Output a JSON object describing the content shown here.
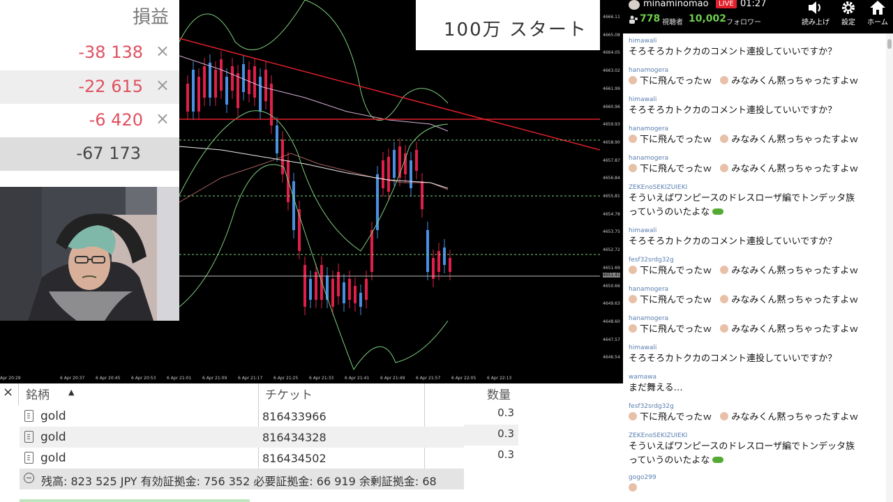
{
  "pl_panel": {
    "header": "損益",
    "rows": [
      {
        "value": "-38 138",
        "close": "×"
      },
      {
        "value": "-22 615",
        "close": "×"
      },
      {
        "value": "-6 420",
        "close": "×"
      }
    ],
    "total": "-67 173"
  },
  "overlay_text": "100万 スタート",
  "price_axis": [
    "4666.11",
    "4665.08",
    "4664.05",
    "4663.02",
    "4661.99",
    "4660.96",
    "4659.93",
    "4658.90",
    "4657.87",
    "4656.84",
    "4655.81",
    "4654.78",
    "4653.75",
    "4652.72",
    "4651.69",
    "4651.41",
    "4650.66",
    "4649.63",
    "4648.60",
    "4647.57",
    "4646.54"
  ],
  "time_axis": [
    "Apr 20:29",
    "6 Apr 20:37",
    "6 Apr 20:45",
    "6 Apr 20:53",
    "6 Apr 21:01",
    "6 Apr 21:09",
    "6 Apr 21:17",
    "6 Apr 21:25",
    "6 Apr 21:33",
    "6 Apr 21:41",
    "6 Apr 21:49",
    "6 Apr 21:57",
    "6 Apr 22:05",
    "6 Apr 22:13"
  ],
  "terminal": {
    "close": "×",
    "headers": {
      "symbol": "銘柄",
      "sort_arrow": "▲",
      "ticket": "チケット",
      "quantity": "数量"
    },
    "rows": [
      {
        "symbol": "gold",
        "ticket": "816433966",
        "quantity": "0.3"
      },
      {
        "symbol": "gold",
        "ticket": "816434328",
        "quantity": "0.3"
      },
      {
        "symbol": "gold",
        "ticket": "816434502",
        "quantity": "0.3"
      }
    ],
    "balance": "残高: 823 525 JPY  有効証拠金: 756 352  必要証拠金: 66 919  余剰証拠金: 68"
  },
  "live": {
    "channel": "minaminomao",
    "badge": "LIVE",
    "time": "01:27",
    "viewers": "778",
    "viewers_label": "視聴者",
    "followers": "10,002",
    "followers_label": "フォロワー",
    "buttons": [
      "読み上げ",
      "設定",
      "ホーム"
    ]
  },
  "chat": [
    {
      "user": "himawali",
      "text": "そろそろカトクカのコメント連投していいですか？"
    },
    {
      "user": "hanamogera",
      "parts": [
        "下に飛んでったｗ",
        "みなみくん黙っちゃったすよｗ"
      ]
    },
    {
      "user": "himawali",
      "text": "そろそろカトクカのコメント連投していいですか？"
    },
    {
      "user": "hanamogera",
      "parts": [
        "下に飛んでったｗ",
        "みなみくん黙っちゃったすよｗ"
      ]
    },
    {
      "user": "hanamogera",
      "parts": [
        "下に飛んでったｗ",
        "みなみくん黙っちゃったすよｗ"
      ]
    },
    {
      "user": "ZEKEnoSEKIZUIEKI",
      "text": "そういえばワンピースのドレスローザ編でトンデッタ族",
      "text2": "っていうのいたよな"
    },
    {
      "user": "himawali",
      "text": "そろそろカトクカのコメント連投していいですか？"
    },
    {
      "user": "fesf32srdg32g",
      "parts": [
        "下に飛んでったｗ",
        "みなみくん黙っちゃったすよｗ"
      ]
    },
    {
      "user": "hanamogera",
      "parts": [
        "下に飛んでったｗ",
        "みなみくん黙っちゃったすよｗ"
      ]
    },
    {
      "user": "hanamogera",
      "parts": [
        "下に飛んでったｗ",
        "みなみくん黙っちゃったすよｗ"
      ]
    },
    {
      "user": "himawali",
      "text": "そろそろカトクカのコメント連投していいですか？"
    },
    {
      "user": "wamawa",
      "text": "まだ舞える…"
    },
    {
      "user": "fesf32srdg32g",
      "parts": [
        "下に飛んでったｗ",
        "みなみくん黙っちゃったすよｗ"
      ]
    },
    {
      "user": "ZEKEnoSEKIZUIEKI",
      "text": "そういえばワンピースのドレスローザ編でトンデッタ族",
      "text2": "っていうのいたよな"
    },
    {
      "user": "gogo299"
    }
  ],
  "colors": {
    "profit_negative": "#e05060",
    "accent_green": "#6fce4c",
    "live_red": "#e0202a",
    "username_blue": "#5a7fb0"
  },
  "icons": [
    "avatar",
    "viewer-icon",
    "speaker-icon",
    "gear-icon",
    "home-icon",
    "close-icon",
    "document-icon",
    "collapse-minus-icon",
    "cursor-icon",
    "smile-emoji-icon",
    "frog-emoji-icon"
  ]
}
